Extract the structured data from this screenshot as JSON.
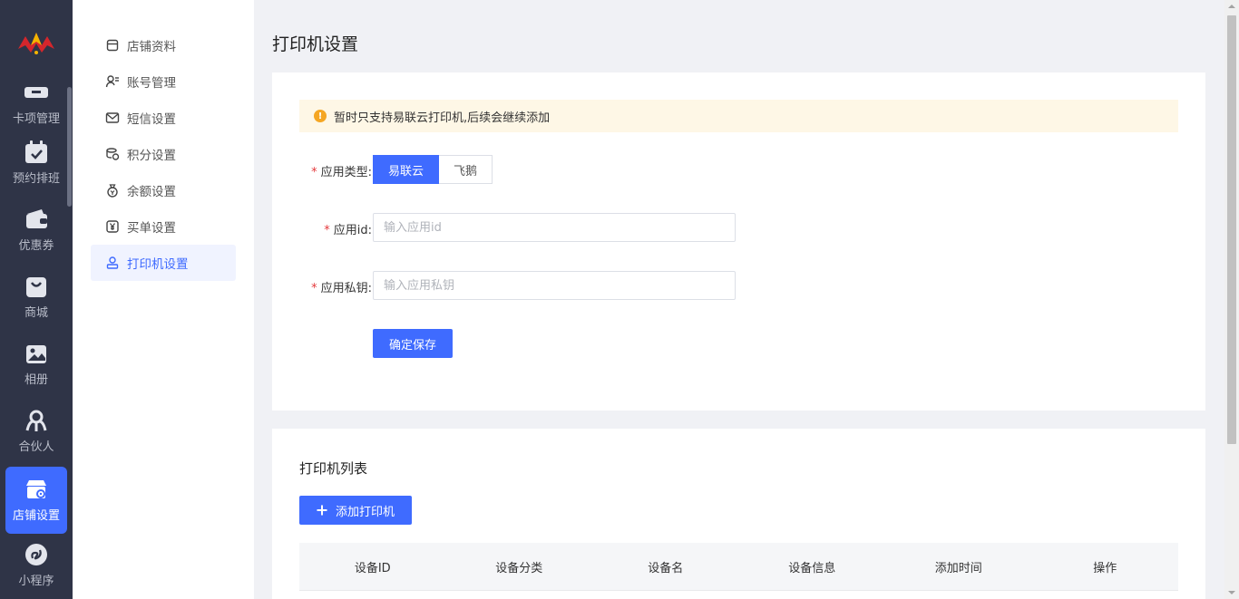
{
  "colors": {
    "accent": "#3f6bff",
    "rail_bg": "#2f3447",
    "notice_bg": "#fef7e6",
    "warning": "#f5a623",
    "required": "#e4393c"
  },
  "rail": {
    "items": [
      {
        "label": "卡项管理",
        "icon": "card-icon"
      },
      {
        "label": "预约排班",
        "icon": "calendar-icon"
      },
      {
        "label": "优惠券",
        "icon": "wallet-icon"
      },
      {
        "label": "商城",
        "icon": "shopping-bag-icon"
      },
      {
        "label": "相册",
        "icon": "image-icon"
      },
      {
        "label": "合伙人",
        "icon": "partner-icon"
      },
      {
        "label": "店铺设置",
        "icon": "store-settings-icon",
        "active": true
      },
      {
        "label": "小程序",
        "icon": "mini-program-icon"
      }
    ]
  },
  "submenu": {
    "items": [
      {
        "label": "店铺资料",
        "icon": "store-icon"
      },
      {
        "label": "账号管理",
        "icon": "user-list-icon"
      },
      {
        "label": "短信设置",
        "icon": "mail-icon"
      },
      {
        "label": "积分设置",
        "icon": "points-icon"
      },
      {
        "label": "余额设置",
        "icon": "money-bag-icon"
      },
      {
        "label": "买单设置",
        "icon": "yen-icon"
      },
      {
        "label": "打印机设置",
        "icon": "user-icon",
        "active": true
      }
    ]
  },
  "page": {
    "title": "打印机设置"
  },
  "notice": {
    "text": "暂时只支持易联云打印机,后续会继续添加"
  },
  "form": {
    "app_type": {
      "label": "应用类型:",
      "options": [
        "易联云",
        "飞鹅"
      ],
      "selected": "易联云"
    },
    "app_id": {
      "label": "应用id:",
      "placeholder": "输入应用id",
      "value": ""
    },
    "app_secret": {
      "label": "应用私钥:",
      "placeholder": "输入应用私钥",
      "value": ""
    },
    "submit_label": "确定保存"
  },
  "printer_list": {
    "title": "打印机列表",
    "add_button": "添加打印机",
    "columns": [
      "设备ID",
      "设备分类",
      "设备名",
      "设备信息",
      "添加时间",
      "操作"
    ]
  }
}
